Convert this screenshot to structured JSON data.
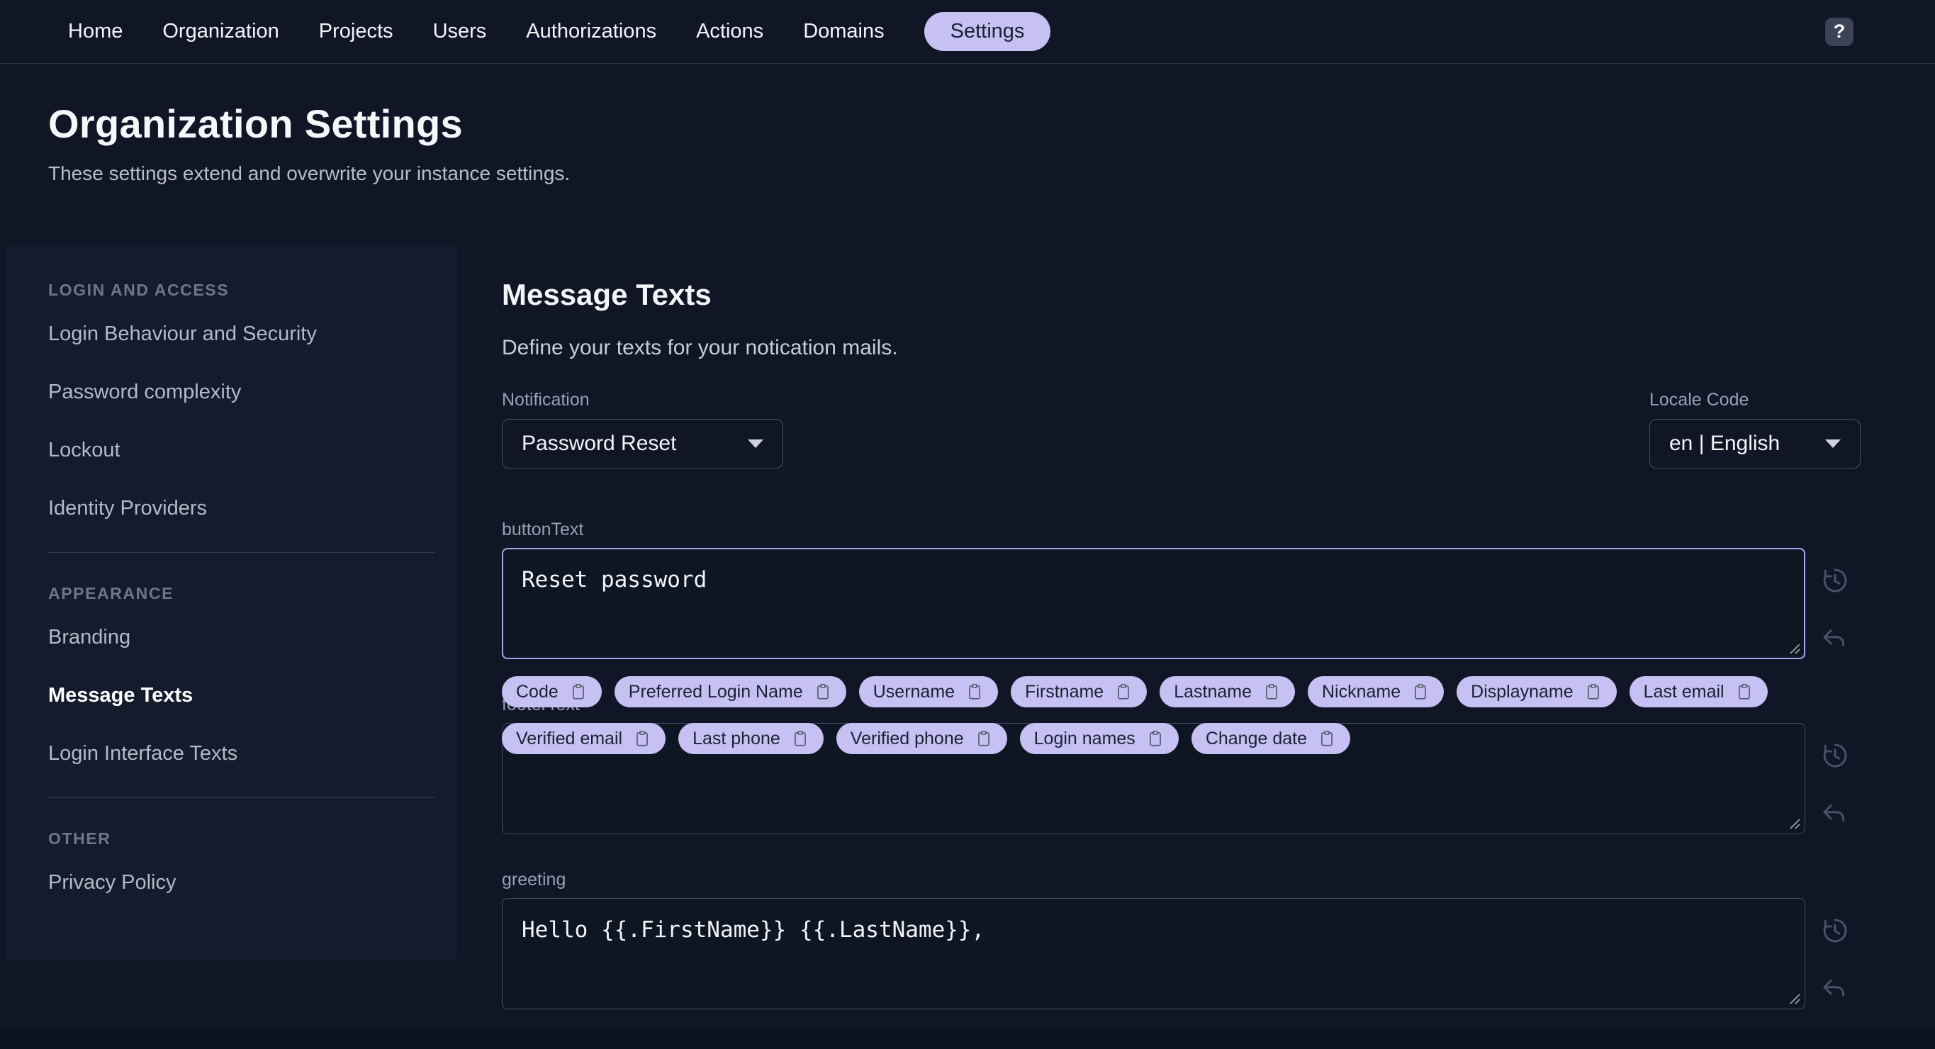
{
  "colors": {
    "accent": "#c7c1f3",
    "background": "#101626",
    "sidebar_background": "#141b2c",
    "focused_border": "#aba5ea"
  },
  "nav": {
    "items": [
      "Home",
      "Organization",
      "Projects",
      "Users",
      "Authorizations",
      "Actions",
      "Domains",
      "Settings"
    ],
    "active_item": "Settings",
    "help_button": "?"
  },
  "page": {
    "title": "Organization Settings",
    "subtitle": "These settings extend and overwrite your instance settings."
  },
  "sidebar": {
    "sections": [
      {
        "title": "LOGIN AND ACCESS",
        "items": [
          "Login Behaviour and Security",
          "Password complexity",
          "Lockout",
          "Identity Providers"
        ]
      },
      {
        "title": "APPEARANCE",
        "items": [
          "Branding",
          "Message Texts",
          "Login Interface Texts"
        ],
        "active_item": "Message Texts"
      },
      {
        "title": "OTHER",
        "items": [
          "Privacy Policy"
        ]
      }
    ]
  },
  "main": {
    "heading": "Message Texts",
    "description": "Define your texts for your notication mails.",
    "notification": {
      "label": "Notification",
      "value": "Password Reset"
    },
    "locale": {
      "label": "Locale Code",
      "value": "en | English"
    },
    "fields": {
      "buttonText": {
        "label": "buttonText",
        "value": "Reset password"
      },
      "footerText": {
        "label": "footerText",
        "value": ""
      },
      "greeting": {
        "label": "greeting",
        "value": "Hello {{.FirstName}} {{.LastName}},"
      }
    },
    "chips": [
      "Code",
      "Preferred Login Name",
      "Username",
      "Firstname",
      "Lastname",
      "Nickname",
      "Displayname",
      "Last email",
      "Verified email",
      "Last phone",
      "Verified phone",
      "Login names",
      "Change date"
    ]
  }
}
